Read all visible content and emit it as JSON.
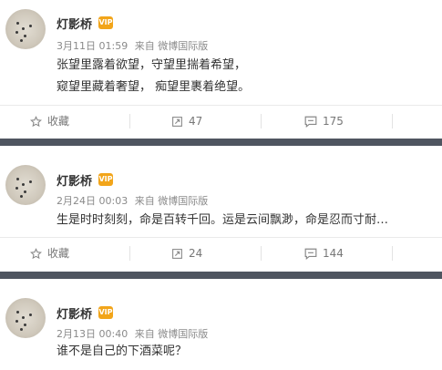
{
  "posts": [
    {
      "username": "灯影桥",
      "vip_badge": "VIP",
      "date": "3月11日 01:59",
      "source": "来自 微博国际版",
      "content_lines": [
        "张望里露着欲望，守望里揣着希望，",
        "窥望里藏着奢望， 痴望里裹着绝望。"
      ],
      "actions": {
        "favorite": "收藏",
        "repost": "47",
        "comment": "175"
      }
    },
    {
      "username": "灯影桥",
      "vip_badge": "VIP",
      "date": "2月24日 00:03",
      "source": "来自 微博国际版",
      "content_lines": [
        "生是时时刻刻，命是百转千回。运是云间飘渺，命是忍而寸耐…"
      ],
      "actions": {
        "favorite": "收藏",
        "repost": "24",
        "comment": "144"
      }
    },
    {
      "username": "灯影桥",
      "vip_badge": "VIP",
      "date": "2月13日 00:40",
      "source": "来自 微博国际版",
      "content_lines": [
        "谁不是自己的下酒菜呢？"
      ]
    }
  ],
  "icons": {
    "favorite": "star-outline-icon",
    "repost": "repost-icon",
    "comment": "comment-icon",
    "vip": "vip-crown-badge-icon"
  },
  "colors": {
    "separator_band": "#4f5560",
    "meta_text": "#8a8a8a",
    "badge": "#f2a51a"
  }
}
